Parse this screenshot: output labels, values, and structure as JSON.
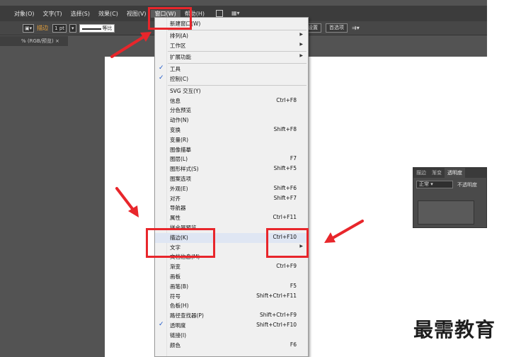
{
  "menubar": {
    "items": [
      "对象(O)",
      "文字(T)",
      "选择(S)",
      "效果(C)",
      "视图(V)",
      "窗口(W)",
      "帮助(H)"
    ],
    "active_index": 5
  },
  "ctrlbar": {
    "stroke_label": "描边",
    "stroke_weight": "1 pt",
    "stroke_style": "等比",
    "btn_settings": "设置",
    "btn_options": "首选项"
  },
  "doctab": {
    "label": "% (RGB/预览)"
  },
  "window_menu": {
    "items": [
      {
        "label": "新建窗口(W)",
        "shortcut": "",
        "arrow": false,
        "check": false
      },
      {
        "sep": true
      },
      {
        "label": "排列(A)",
        "shortcut": "",
        "arrow": true,
        "check": false
      },
      {
        "label": "工作区",
        "shortcut": "",
        "arrow": true,
        "check": false
      },
      {
        "sep": true
      },
      {
        "label": "扩展功能",
        "shortcut": "",
        "arrow": true,
        "check": false
      },
      {
        "sep": true
      },
      {
        "label": "工具",
        "shortcut": "",
        "arrow": false,
        "check": true
      },
      {
        "label": "控制(C)",
        "shortcut": "",
        "arrow": false,
        "check": true
      },
      {
        "sep": true
      },
      {
        "label": "SVG 交互(Y)",
        "shortcut": "",
        "arrow": false,
        "check": false
      },
      {
        "label": "信息",
        "shortcut": "Ctrl+F8",
        "arrow": false,
        "check": false
      },
      {
        "label": "分色预览",
        "shortcut": "",
        "arrow": false,
        "check": false
      },
      {
        "label": "动作(N)",
        "shortcut": "",
        "arrow": false,
        "check": false
      },
      {
        "label": "变换",
        "shortcut": "Shift+F8",
        "arrow": false,
        "check": false
      },
      {
        "label": "变量(R)",
        "shortcut": "",
        "arrow": false,
        "check": false
      },
      {
        "label": "图像描摹",
        "shortcut": "",
        "arrow": false,
        "check": false
      },
      {
        "label": "图层(L)",
        "shortcut": "F7",
        "arrow": false,
        "check": false
      },
      {
        "label": "图形样式(S)",
        "shortcut": "Shift+F5",
        "arrow": false,
        "check": false
      },
      {
        "label": "图案选项",
        "shortcut": "",
        "arrow": false,
        "check": false
      },
      {
        "label": "外观(E)",
        "shortcut": "Shift+F6",
        "arrow": false,
        "check": false
      },
      {
        "label": "对齐",
        "shortcut": "Shift+F7",
        "arrow": false,
        "check": false
      },
      {
        "label": "导航器",
        "shortcut": "",
        "arrow": false,
        "check": false
      },
      {
        "label": "属性",
        "shortcut": "Ctrl+F11",
        "arrow": false,
        "check": false
      },
      {
        "label": "拼合器预览",
        "shortcut": "",
        "arrow": false,
        "check": false
      },
      {
        "label": "描边(K)",
        "shortcut": "Ctrl+F10",
        "arrow": false,
        "check": false,
        "highlight": true
      },
      {
        "label": "文字",
        "shortcut": "",
        "arrow": true,
        "check": false
      },
      {
        "label": "文档信息(M)",
        "shortcut": "",
        "arrow": false,
        "check": false
      },
      {
        "label": "渐变",
        "shortcut": "Ctrl+F9",
        "arrow": false,
        "check": false
      },
      {
        "label": "画板",
        "shortcut": "",
        "arrow": false,
        "check": false
      },
      {
        "label": "画笔(B)",
        "shortcut": "F5",
        "arrow": false,
        "check": false
      },
      {
        "label": "符号",
        "shortcut": "Shift+Ctrl+F11",
        "arrow": false,
        "check": false
      },
      {
        "label": "色板(H)",
        "shortcut": "",
        "arrow": false,
        "check": false
      },
      {
        "label": "路径查找器(P)",
        "shortcut": "Shift+Ctrl+F9",
        "arrow": false,
        "check": false
      },
      {
        "label": "透明度",
        "shortcut": "Shift+Ctrl+F10",
        "arrow": false,
        "check": true
      },
      {
        "label": "链接(I)",
        "shortcut": "",
        "arrow": false,
        "check": false
      },
      {
        "label": "颜色",
        "shortcut": "F6",
        "arrow": false,
        "check": false
      }
    ]
  },
  "transparency_panel": {
    "tabs": [
      "描边",
      "渐变",
      "透明度"
    ],
    "blend_mode": "正常",
    "opacity_label": "不透明度"
  },
  "watermark": "最需教育",
  "colors": {
    "annotation_red": "#e8262b",
    "check_blue": "#1a56c8"
  }
}
